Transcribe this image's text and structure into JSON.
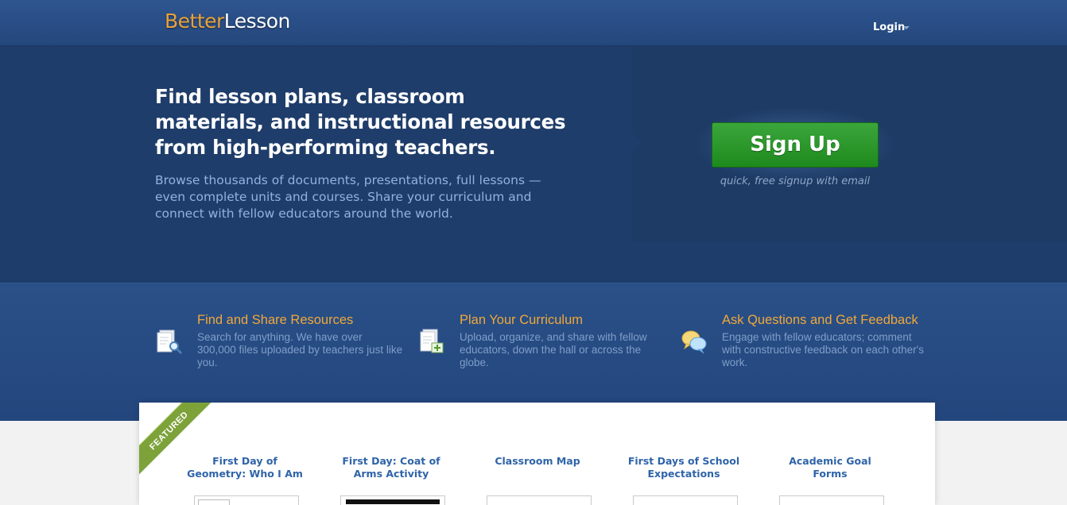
{
  "header": {
    "logo_part1": "Better",
    "logo_part2": "Lesson",
    "login_label": "Login"
  },
  "hero": {
    "headline": "Find lesson plans, classroom materials, and instructional resources from high-performing teachers.",
    "subtext": "Browse thousands of documents, presentations, full lessons — even complete units and courses. Share your curriculum and connect with fellow educators around the world.",
    "signup_label": "Sign Up",
    "signup_note": "quick, free signup with email"
  },
  "features": [
    {
      "icon": "document-search-icon",
      "title": "Find and Share Resources",
      "desc": "Search for anything. We have over 300,000 files uploaded by teachers just like you."
    },
    {
      "icon": "document-upload-icon",
      "title": "Plan Your Curriculum",
      "desc": "Upload, organize, and share with fellow educators, down the hall or across the globe."
    },
    {
      "icon": "chat-bubbles-icon",
      "title": "Ask Questions and Get Feedback",
      "desc": "Engage with fellow educators; comment with constructive feedback on each other's work."
    }
  ],
  "featured": {
    "ribbon_label": "FEATURED",
    "items": [
      {
        "title": "First Day of Geometry: Who I Am"
      },
      {
        "title": "First Day: Coat of Arms Activity"
      },
      {
        "title": "Classroom Map"
      },
      {
        "title": "First Days of School Expectations"
      },
      {
        "title": "Academic Goal Forms"
      }
    ]
  },
  "colors": {
    "header_bg": "#2f5590",
    "hero_bg": "#1f3d6a",
    "accent_orange": "#f0a83a",
    "signup_green": "#2a9a2a",
    "link_blue": "#2f64a8"
  }
}
